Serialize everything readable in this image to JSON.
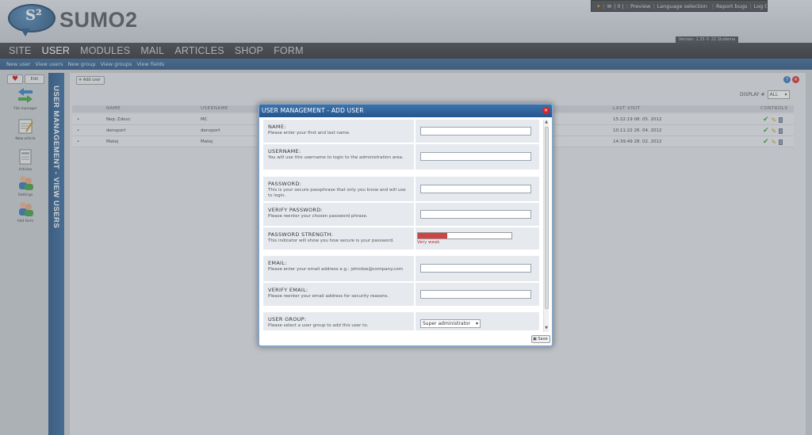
{
  "app": {
    "logo_text": "SUMO2",
    "logo_mark": "S²",
    "version": "Version: 1.33 © 22 Studema"
  },
  "topbar": {
    "count": "| 0 |",
    "links": [
      "Preview",
      "Language selection",
      "Report bugs",
      "Log Out"
    ]
  },
  "nav": {
    "items": [
      "SITE",
      "USER",
      "MODULES",
      "MAIL",
      "ARTICLES",
      "SHOP",
      "FORM"
    ],
    "active": "USER"
  },
  "subnav": {
    "items": [
      "New user",
      "View users",
      "New group",
      "View groups",
      "View fields"
    ]
  },
  "left_tools": {
    "edit_label": "Edit",
    "items": [
      {
        "label": "File manager",
        "icon": "arrows-icon"
      },
      {
        "label": "New article",
        "icon": "notepad-icon"
      },
      {
        "label": "Articles",
        "icon": "document-icon"
      },
      {
        "label": "Settings",
        "icon": "users-settings-icon"
      },
      {
        "label": "Add form",
        "icon": "users-add-icon"
      }
    ]
  },
  "vertical_title": "USER MANAGEMENT - VIEW USERS",
  "panel": {
    "add_user_label": "Add user",
    "display_label": "DISPLAY #",
    "display_value": "ALL",
    "columns": [
      "NAME",
      "USERNAME",
      "LAST VISIT",
      "CONTROLS"
    ],
    "rows": [
      {
        "marker": "•",
        "name": "Nejc Zdovc",
        "username": "MC",
        "last_visit": "15:22:19 08. 05. 2012"
      },
      {
        "marker": "•",
        "name": "densport",
        "username": "densport",
        "last_visit": "10:11:22 26. 04. 2012"
      },
      {
        "marker": "•",
        "name": "Matej",
        "username": "Matej",
        "last_visit": "14:39:49 28. 02. 2012"
      }
    ]
  },
  "modal": {
    "title": "USER MANAGEMENT - ADD USER",
    "fields": [
      {
        "label": "NAME:",
        "hint": "Please enter your first and last name.",
        "value": ""
      },
      {
        "label": "USERNAME:",
        "hint": "You will use this username to login to the administration area.",
        "value": ""
      },
      {
        "label": "PASSWORD:",
        "hint": "This is your secure passphrase that only you know and will use to login.",
        "value": ""
      },
      {
        "label": "VERIFY PASSWORD:",
        "hint": "Please reenter your chosen password phrase.",
        "value": ""
      },
      {
        "label": "PASSWORD STRENGTH:",
        "hint": "This indicator will show you how secure is your password.",
        "strength_text": "Very weak",
        "strength_level": 0.31
      },
      {
        "label": "EMAIL:",
        "hint": "Please enter your email address e.g.: johndoe@company.com",
        "value": ""
      },
      {
        "label": "VERIFY EMAIL:",
        "hint": "Please reenter your email address for security reasons.",
        "value": ""
      },
      {
        "label": "USER GROUP:",
        "hint": "Please select a user group to add this user to.",
        "selected": "Super administrator"
      }
    ],
    "save_label": "Save"
  },
  "colors": {
    "accent": "#25568e",
    "strength_weak": "#cc4444"
  }
}
